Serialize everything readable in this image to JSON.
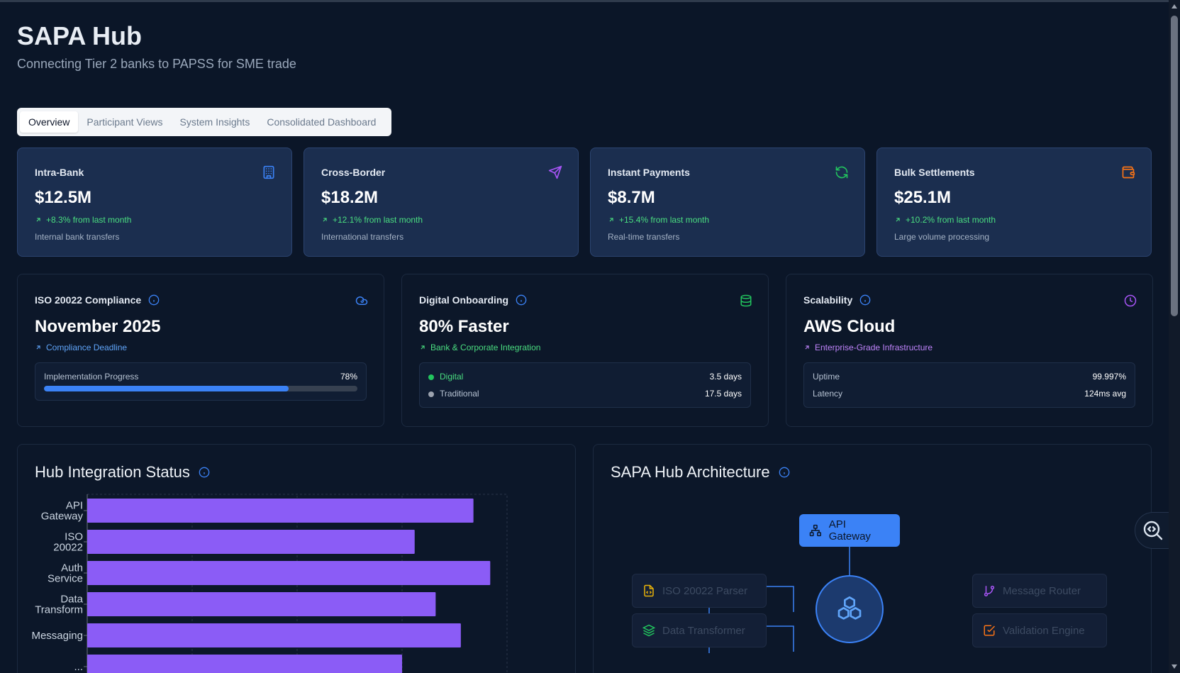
{
  "header": {
    "title": "SAPA Hub",
    "subtitle": "Connecting Tier 2 banks to PAPSS for SME trade"
  },
  "tabs": [
    {
      "label": "Overview",
      "active": true
    },
    {
      "label": "Participant Views",
      "active": false
    },
    {
      "label": "System Insights",
      "active": false
    },
    {
      "label": "Consolidated Dashboard",
      "active": false
    }
  ],
  "kpis": [
    {
      "label": "Intra-Bank",
      "value": "$12.5M",
      "change": "+8.3% from last month",
      "desc": "Internal bank transfers",
      "icon": "building-icon",
      "color": "#3b82f6"
    },
    {
      "label": "Cross-Border",
      "value": "$18.2M",
      "change": "+12.1% from last month",
      "desc": "International transfers",
      "icon": "send-icon",
      "color": "#a855f7"
    },
    {
      "label": "Instant Payments",
      "value": "$8.7M",
      "change": "+15.4% from last month",
      "desc": "Real-time transfers",
      "icon": "refresh-icon",
      "color": "#22c55e"
    },
    {
      "label": "Bulk Settlements",
      "value": "$25.1M",
      "change": "+10.2% from last month",
      "desc": "Large volume processing",
      "icon": "wallet-icon",
      "color": "#f97316"
    }
  ],
  "metrics": {
    "iso": {
      "label": "ISO 20022 Compliance",
      "value": "November 2025",
      "sub": "Compliance Deadline",
      "sub_color": "#60a5fa",
      "progress_label": "Implementation Progress",
      "progress_text": "78%",
      "progress_value": 78,
      "icon": "cloud-sync-icon"
    },
    "onboarding": {
      "label": "Digital Onboarding",
      "value": "80% Faster",
      "sub": "Bank & Corporate Integration",
      "sub_color": "#4ade80",
      "rows": [
        {
          "label": "Digital",
          "value": "3.5 days",
          "color": "#22c55e"
        },
        {
          "label": "Traditional",
          "value": "17.5 days",
          "color": "#9ca3af"
        }
      ],
      "icon": "database-icon"
    },
    "scalability": {
      "label": "Scalability",
      "value": "AWS Cloud",
      "sub": "Enterprise-Grade Infrastructure",
      "sub_color": "#c084fc",
      "rows": [
        {
          "label": "Uptime",
          "value": "99.997%"
        },
        {
          "label": "Latency",
          "value": "124ms avg"
        }
      ],
      "icon": "clock-icon"
    }
  },
  "integration": {
    "title": "Hub Integration Status"
  },
  "chart_data": {
    "type": "bar",
    "orientation": "horizontal",
    "categories": [
      [
        "API",
        "Gateway"
      ],
      [
        "ISO",
        "20022"
      ],
      [
        "Auth",
        "Service"
      ],
      [
        "Data",
        "Transform"
      ],
      [
        "Messaging"
      ],
      [
        "..."
      ]
    ],
    "values": [
      92,
      78,
      96,
      83,
      89,
      75
    ],
    "xlim": [
      0,
      100
    ],
    "grid": true,
    "color": "#8b5cf6"
  },
  "architecture": {
    "title": "SAPA Hub Architecture",
    "gateway_label": "API Gateway",
    "nodes_left": [
      {
        "label": "ISO 20022 Parser",
        "icon": "file-code-icon",
        "color": "#eab308"
      },
      {
        "label": "Data Transformer",
        "icon": "layers-icon",
        "color": "#22c55e"
      }
    ],
    "nodes_right": [
      {
        "label": "Message Router",
        "icon": "git-branch-icon",
        "color": "#a855f7"
      },
      {
        "label": "Validation Engine",
        "icon": "check-square-icon",
        "color": "#f97316"
      }
    ]
  }
}
